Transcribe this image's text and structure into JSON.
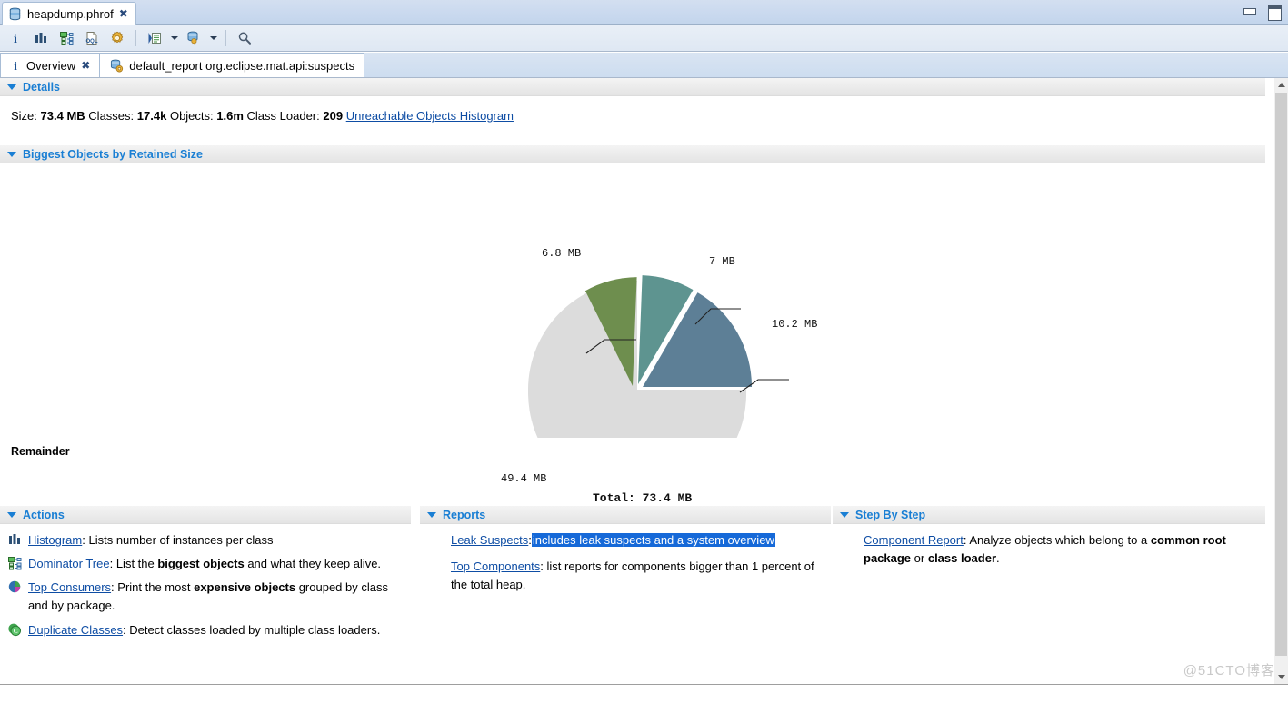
{
  "window": {
    "editor_tab": "heapdump.phrof",
    "tab_close_icon": "close-icon",
    "minimize_label": "Minimize",
    "maximize_label": "Maximize"
  },
  "toolbar": {
    "buttons": [
      {
        "name": "overview-info-icon",
        "title": "Overview"
      },
      {
        "name": "histogram-icon",
        "title": "Histogram"
      },
      {
        "name": "dominator-tree-icon",
        "title": "Dominator Tree"
      },
      {
        "name": "oql-icon",
        "title": "OQL Studio"
      },
      {
        "name": "calculate-icon",
        "title": "Calculate Retained Size"
      },
      {
        "name": "query-browser-icon",
        "title": "Query Browser"
      },
      {
        "name": "run-expert-system-icon",
        "title": "Run Expert System Test"
      },
      {
        "name": "search-icon",
        "title": "Find"
      }
    ]
  },
  "viewtabs": [
    {
      "label": "Overview",
      "icon": "info-icon",
      "active": true,
      "closable": true
    },
    {
      "label": "default_report  org.eclipse.mat.api:suspects",
      "icon": "report-icon",
      "active": false,
      "closable": false
    }
  ],
  "details": {
    "header": "Details",
    "size_label": "Size:",
    "size_value": "73.4 MB",
    "classes_label": "Classes:",
    "classes_value": "17.4k",
    "objects_label": "Objects:",
    "objects_value": "1.6m",
    "classloader_label": "Class Loader:",
    "classloader_value": "209",
    "unreachable_link": "Unreachable Objects Histogram"
  },
  "biggest": {
    "header": "Biggest Objects by Retained Size",
    "remainder_label": "Remainder"
  },
  "chart_data": {
    "type": "pie",
    "title": "Biggest Objects by Retained Size",
    "total_label": "Total: 73.4 MB",
    "total_value": 73.4,
    "unit": "MB",
    "labels": [
      "10.2 MB",
      "7 MB",
      "6.8 MB",
      "49.4 MB"
    ],
    "values": [
      10.2,
      7,
      6.8,
      49.4
    ],
    "colors": [
      "#5d7f96",
      "#5e9490",
      "#6e8e4e",
      "#dcdcdc"
    ],
    "exploded": [
      true,
      true,
      true,
      false
    ],
    "legend": "none",
    "grid": false
  },
  "actions": {
    "header": "Actions",
    "items": [
      {
        "icon": "histogram-icon",
        "link": "Histogram",
        "sep": ":",
        "text": " Lists number of instances per class",
        "bold": []
      },
      {
        "icon": "dominator-tree-icon",
        "link": "Dominator Tree",
        "sep": ":",
        "text": " List the ",
        "bold_text": "biggest objects",
        "text2": " and what they keep alive."
      },
      {
        "icon": "top-consumers-icon",
        "link": "Top Consumers",
        "sep": ":",
        "text": " Print the most ",
        "bold_text": "expensive objects",
        "text2": " grouped by class and by package."
      },
      {
        "icon": "duplicate-classes-icon",
        "link": "Duplicate Classes",
        "sep": ":",
        "text": " Detect classes loaded by multiple class loaders.",
        "bold_text": "",
        "text2": ""
      }
    ]
  },
  "reports": {
    "header": "Reports",
    "items": [
      {
        "link": "Leak Suspects",
        "sep": ":",
        "selected_text": "includes leak suspects and a system overview",
        "text": "",
        "selected": true
      },
      {
        "link": "Top Components",
        "sep": ":",
        "text": " list reports for components bigger than 1 percent of the total heap.",
        "selected": false
      }
    ]
  },
  "stepbystep": {
    "header": "Step By Step",
    "items": [
      {
        "link": "Component Report",
        "sep": ":",
        "text": " Analyze objects which belong to a ",
        "bold_text": "common root package",
        "text_mid": " or ",
        "bold_text2": "class loader",
        "text2": "."
      }
    ]
  },
  "watermark": "@51CTO博客",
  "colors": {
    "link": "#0e4da4",
    "section_header": "#1a7fd4",
    "selection": "#1669d8"
  }
}
